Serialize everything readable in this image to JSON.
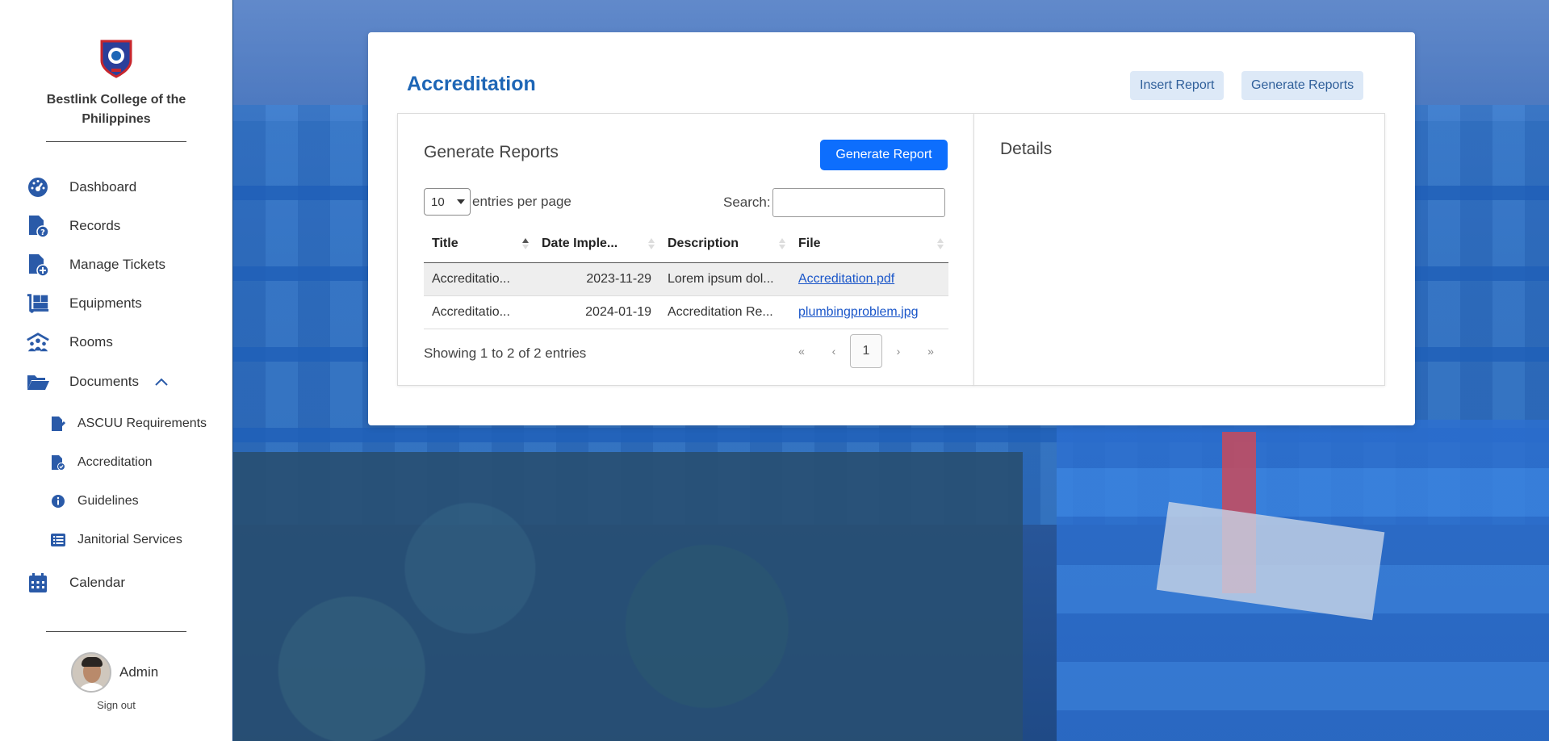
{
  "sidebar": {
    "college_name": "Bestlink College of the Philippines",
    "items": [
      {
        "label": "Dashboard",
        "icon": "dashboard-gauge-icon"
      },
      {
        "label": "Records",
        "icon": "file-question-icon"
      },
      {
        "label": "Manage Tickets",
        "icon": "file-plus-icon"
      },
      {
        "label": "Equipments",
        "icon": "dolly-boxes-icon"
      },
      {
        "label": "Rooms",
        "icon": "people-roof-icon"
      },
      {
        "label": "Documents",
        "icon": "folder-open-icon",
        "expanded": true
      },
      {
        "label": "Calendar",
        "icon": "calendar-icon"
      }
    ],
    "sub_items": [
      {
        "label": "ASCUU Requirements",
        "icon": "file-pen-icon"
      },
      {
        "label": "Accreditation",
        "icon": "file-check-icon"
      },
      {
        "label": "Guidelines",
        "icon": "info-circle-icon"
      },
      {
        "label": "Janitorial Services",
        "icon": "list-icon"
      }
    ],
    "user": {
      "name": "Admin",
      "signout": "Sign out"
    }
  },
  "page": {
    "title": "Accreditation",
    "insert_report_label": "Insert Report",
    "generate_reports_label": "Generate Reports"
  },
  "reports_panel": {
    "title": "Generate Reports",
    "generate_button": "Generate Report",
    "per_page_value": "10",
    "per_page_text": "entries per page",
    "search_label": "Search:",
    "search_value": "",
    "columns": [
      "Title",
      "Date Imple...",
      "Description",
      "File"
    ],
    "rows": [
      {
        "title": "Accreditatio...",
        "date": "2023-11-29",
        "description": "Lorem ipsum dol...",
        "file": "Accreditation.pdf"
      },
      {
        "title": "Accreditatio...",
        "date": "2024-01-19",
        "description": "Accreditation Re...",
        "file": "plumbingproblem.jpg"
      }
    ],
    "info": "Showing 1 to 2 of 2 entries",
    "pager": {
      "first": "«",
      "prev": "‹",
      "current": "1",
      "next": "›",
      "last": "»"
    }
  },
  "details_panel": {
    "title": "Details"
  },
  "colors": {
    "accent": "#1e66b6",
    "primary_button": "#0d6efd",
    "header_button_bg": "#dde9f7",
    "link": "#1a56c9"
  }
}
